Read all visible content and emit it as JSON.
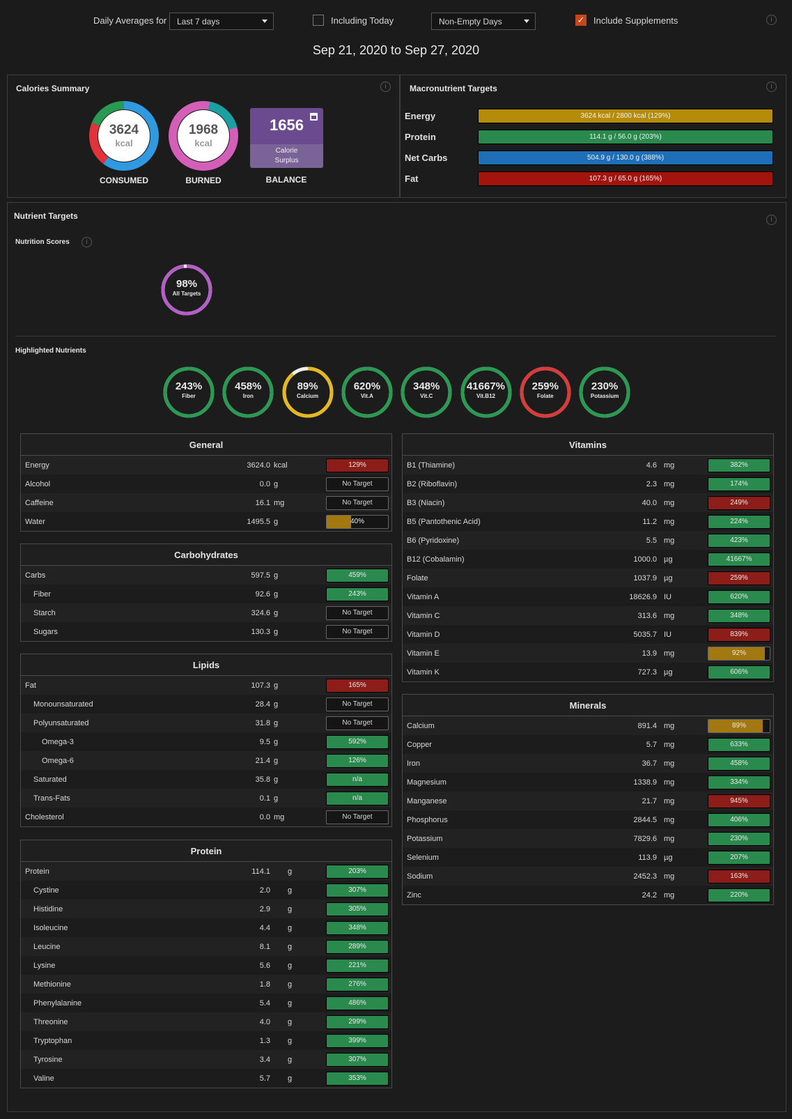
{
  "controls": {
    "daily_averages_label": "Daily Averages for",
    "period_value": "Last 7 days",
    "including_today_label": "Including Today",
    "including_today_checked": false,
    "days_filter_value": "Non-Empty Days",
    "include_supplements_label": "Include Supplements",
    "include_supplements_checked": true
  },
  "date_range": "Sep 21, 2020 to Sep 27, 2020",
  "calories_summary": {
    "title": "Calories Summary",
    "consumed": {
      "value": "3624",
      "unit": "kcal",
      "label": "CONSUMED"
    },
    "burned": {
      "value": "1968",
      "unit": "kcal",
      "label": "BURNED"
    },
    "balance": {
      "value": "1656",
      "sub_line1": "Calorie",
      "sub_line2": "Surplus",
      "label": "BALANCE"
    }
  },
  "macronutrient_targets": {
    "title": "Macronutrient Targets",
    "items": [
      {
        "name": "Energy",
        "text": "3624 kcal / 2800 kcal (129%)",
        "color": "#b58c0a"
      },
      {
        "name": "Protein",
        "text": "114.1 g / 56.0 g (203%)",
        "color": "#2a8a4e"
      },
      {
        "name": "Net Carbs",
        "text": "504.9 g / 130.0 g (388%)",
        "color": "#1e6fb8"
      },
      {
        "name": "Fat",
        "text": "107.3 g / 65.0 g (165%)",
        "color": "#a3140f"
      }
    ]
  },
  "nutrient_targets": {
    "title": "Nutrient Targets",
    "scores_title": "Nutrition Scores",
    "all_targets": {
      "pct": "98%",
      "name": "All Targets",
      "fraction": 0.98,
      "color": "#b55ec8"
    },
    "highlighted_title": "Highlighted Nutrients",
    "highlighted": [
      {
        "pct": "243%",
        "name": "Fiber",
        "fraction": 1,
        "color": "#2a9a52"
      },
      {
        "pct": "458%",
        "name": "Iron",
        "fraction": 1,
        "color": "#2a9a52"
      },
      {
        "pct": "89%",
        "name": "Calcium",
        "fraction": 0.89,
        "color": "#e5b820"
      },
      {
        "pct": "620%",
        "name": "Vit.A",
        "fraction": 1,
        "color": "#2a9a52"
      },
      {
        "pct": "348%",
        "name": "Vit.C",
        "fraction": 1,
        "color": "#2a9a52"
      },
      {
        "pct": "41667%",
        "name": "Vit.B12",
        "fraction": 1,
        "color": "#2a9a52"
      },
      {
        "pct": "259%",
        "name": "Folate",
        "fraction": 1,
        "color": "#d93a3a"
      },
      {
        "pct": "230%",
        "name": "Potassium",
        "fraction": 1,
        "color": "#2a9a52"
      }
    ]
  },
  "tables": {
    "general": {
      "title": "General",
      "rows": [
        {
          "name": "Energy",
          "value": "3624.0",
          "unit": "kcal",
          "bar": "129%",
          "status": "red",
          "indent": 0
        },
        {
          "name": "Alcohol",
          "value": "0.0",
          "unit": "g",
          "bar": "No Target",
          "status": "none",
          "indent": 0
        },
        {
          "name": "Caffeine",
          "value": "16.1",
          "unit": "mg",
          "bar": "No Target",
          "status": "none",
          "indent": 0
        },
        {
          "name": "Water",
          "value": "1495.5",
          "unit": "g",
          "bar": "40%",
          "status": "gold",
          "fraction": 0.4,
          "indent": 0
        }
      ]
    },
    "carbohydrates": {
      "title": "Carbohydrates",
      "rows": [
        {
          "name": "Carbs",
          "value": "597.5",
          "unit": "g",
          "bar": "459%",
          "status": "green",
          "indent": 0
        },
        {
          "name": "Fiber",
          "value": "92.6",
          "unit": "g",
          "bar": "243%",
          "status": "green",
          "indent": 1
        },
        {
          "name": "Starch",
          "value": "324.6",
          "unit": "g",
          "bar": "No Target",
          "status": "none",
          "indent": 1
        },
        {
          "name": "Sugars",
          "value": "130.3",
          "unit": "g",
          "bar": "No Target",
          "status": "none",
          "indent": 1
        }
      ]
    },
    "lipids": {
      "title": "Lipids",
      "rows": [
        {
          "name": "Fat",
          "value": "107.3",
          "unit": "g",
          "bar": "165%",
          "status": "red",
          "indent": 0
        },
        {
          "name": "Monounsaturated",
          "value": "28.4",
          "unit": "g",
          "bar": "No Target",
          "status": "none",
          "indent": 1
        },
        {
          "name": "Polyunsaturated",
          "value": "31.8",
          "unit": "g",
          "bar": "No Target",
          "status": "none",
          "indent": 1
        },
        {
          "name": "Omega-3",
          "value": "9.5",
          "unit": "g",
          "bar": "592%",
          "status": "green",
          "indent": 2
        },
        {
          "name": "Omega-6",
          "value": "21.4",
          "unit": "g",
          "bar": "126%",
          "status": "green",
          "indent": 2
        },
        {
          "name": "Saturated",
          "value": "35.8",
          "unit": "g",
          "bar": "n/a",
          "status": "green",
          "indent": 1
        },
        {
          "name": "Trans-Fats",
          "value": "0.1",
          "unit": "g",
          "bar": "n/a",
          "status": "green",
          "indent": 1
        },
        {
          "name": "Cholesterol",
          "value": "0.0",
          "unit": "mg",
          "bar": "No Target",
          "status": "none",
          "indent": 0
        }
      ]
    },
    "protein": {
      "title": "Protein",
      "rows": [
        {
          "name": "Protein",
          "value": "114.1",
          "unit": "g",
          "bar": "203%",
          "status": "green",
          "indent": 0
        },
        {
          "name": "Cystine",
          "value": "2.0",
          "unit": "g",
          "bar": "307%",
          "status": "green",
          "indent": 1
        },
        {
          "name": "Histidine",
          "value": "2.9",
          "unit": "g",
          "bar": "305%",
          "status": "green",
          "indent": 1
        },
        {
          "name": "Isoleucine",
          "value": "4.4",
          "unit": "g",
          "bar": "348%",
          "status": "green",
          "indent": 1
        },
        {
          "name": "Leucine",
          "value": "8.1",
          "unit": "g",
          "bar": "289%",
          "status": "green",
          "indent": 1
        },
        {
          "name": "Lysine",
          "value": "5.6",
          "unit": "g",
          "bar": "221%",
          "status": "green",
          "indent": 1
        },
        {
          "name": "Methionine",
          "value": "1.8",
          "unit": "g",
          "bar": "276%",
          "status": "green",
          "indent": 1
        },
        {
          "name": "Phenylalanine",
          "value": "5.4",
          "unit": "g",
          "bar": "486%",
          "status": "green",
          "indent": 1
        },
        {
          "name": "Threonine",
          "value": "4.0",
          "unit": "g",
          "bar": "299%",
          "status": "green",
          "indent": 1
        },
        {
          "name": "Tryptophan",
          "value": "1.3",
          "unit": "g",
          "bar": "399%",
          "status": "green",
          "indent": 1
        },
        {
          "name": "Tyrosine",
          "value": "3.4",
          "unit": "g",
          "bar": "307%",
          "status": "green",
          "indent": 1
        },
        {
          "name": "Valine",
          "value": "5.7",
          "unit": "g",
          "bar": "353%",
          "status": "green",
          "indent": 1
        }
      ]
    },
    "vitamins": {
      "title": "Vitamins",
      "rows": [
        {
          "name": "B1 (Thiamine)",
          "value": "4.6",
          "unit": "mg",
          "bar": "382%",
          "status": "green",
          "indent": 0
        },
        {
          "name": "B2 (Riboflavin)",
          "value": "2.3",
          "unit": "mg",
          "bar": "174%",
          "status": "green",
          "indent": 0
        },
        {
          "name": "B3 (Niacin)",
          "value": "40.0",
          "unit": "mg",
          "bar": "249%",
          "status": "red",
          "indent": 0
        },
        {
          "name": "B5 (Pantothenic Acid)",
          "value": "11.2",
          "unit": "mg",
          "bar": "224%",
          "status": "green",
          "indent": 0
        },
        {
          "name": "B6 (Pyridoxine)",
          "value": "5.5",
          "unit": "mg",
          "bar": "423%",
          "status": "green",
          "indent": 0
        },
        {
          "name": "B12 (Cobalamin)",
          "value": "1000.0",
          "unit": "µg",
          "bar": "41667%",
          "status": "green",
          "indent": 0
        },
        {
          "name": "Folate",
          "value": "1037.9",
          "unit": "µg",
          "bar": "259%",
          "status": "red",
          "indent": 0
        },
        {
          "name": "Vitamin A",
          "value": "18626.9",
          "unit": "IU",
          "bar": "620%",
          "status": "green",
          "indent": 0
        },
        {
          "name": "Vitamin C",
          "value": "313.6",
          "unit": "mg",
          "bar": "348%",
          "status": "green",
          "indent": 0
        },
        {
          "name": "Vitamin D",
          "value": "5035.7",
          "unit": "IU",
          "bar": "839%",
          "status": "red",
          "indent": 0
        },
        {
          "name": "Vitamin E",
          "value": "13.9",
          "unit": "mg",
          "bar": "92%",
          "status": "gold",
          "fraction": 0.92,
          "indent": 0
        },
        {
          "name": "Vitamin K",
          "value": "727.3",
          "unit": "µg",
          "bar": "606%",
          "status": "green",
          "indent": 0
        }
      ]
    },
    "minerals": {
      "title": "Minerals",
      "rows": [
        {
          "name": "Calcium",
          "value": "891.4",
          "unit": "mg",
          "bar": "89%",
          "status": "gold",
          "fraction": 0.89,
          "indent": 0
        },
        {
          "name": "Copper",
          "value": "5.7",
          "unit": "mg",
          "bar": "633%",
          "status": "green",
          "indent": 0
        },
        {
          "name": "Iron",
          "value": "36.7",
          "unit": "mg",
          "bar": "458%",
          "status": "green",
          "indent": 0
        },
        {
          "name": "Magnesium",
          "value": "1338.9",
          "unit": "mg",
          "bar": "334%",
          "status": "green",
          "indent": 0
        },
        {
          "name": "Manganese",
          "value": "21.7",
          "unit": "mg",
          "bar": "945%",
          "status": "red",
          "indent": 0
        },
        {
          "name": "Phosphorus",
          "value": "2844.5",
          "unit": "mg",
          "bar": "406%",
          "status": "green",
          "indent": 0
        },
        {
          "name": "Potassium",
          "value": "7829.6",
          "unit": "mg",
          "bar": "230%",
          "status": "green",
          "indent": 0
        },
        {
          "name": "Selenium",
          "value": "113.9",
          "unit": "µg",
          "bar": "207%",
          "status": "green",
          "indent": 0
        },
        {
          "name": "Sodium",
          "value": "2452.3",
          "unit": "mg",
          "bar": "163%",
          "status": "red",
          "indent": 0
        },
        {
          "name": "Zinc",
          "value": "24.2",
          "unit": "mg",
          "bar": "220%",
          "status": "green",
          "indent": 0
        }
      ]
    }
  }
}
